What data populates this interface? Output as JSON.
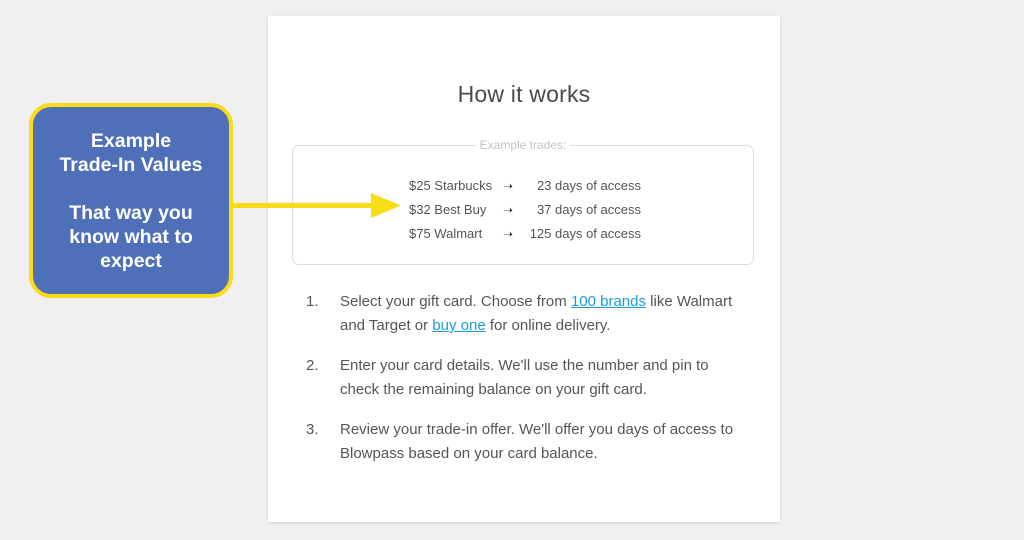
{
  "card": {
    "title": "How it works",
    "example_trades": {
      "legend": "Example trades:",
      "arrow_glyph": "➝",
      "rows": [
        {
          "from": "$25 Starbucks",
          "to": "23 days of access"
        },
        {
          "from": "$32 Best Buy",
          "to": "37 days of access"
        },
        {
          "from": "$75 Walmart",
          "to": "125 days of access"
        }
      ]
    },
    "steps": [
      {
        "number": "1.",
        "text_before": "Select your gift card. Choose from ",
        "link1": "100 brands",
        "text_middle": " like Walmart and Target or ",
        "link2": "buy one",
        "text_after": " for online delivery."
      },
      {
        "number": "2.",
        "text": "Enter your card details. We'll use the number and pin to check the remaining balance on your gift card."
      },
      {
        "number": "3.",
        "text": "Review your trade-in offer. We'll offer you days of access to Blowpass based on your card balance."
      }
    ]
  },
  "annotation": {
    "heading_line1": "Example",
    "heading_line2": "Trade-In Values",
    "body_line1": "That way you",
    "body_line2": "know what to",
    "body_line3": "expect",
    "fill_color": "#4f6fb8",
    "border_color": "#f7dc16",
    "arrow_color": "#f7dc16",
    "arrow_icon": "arrow-right-icon"
  },
  "colors": {
    "background": "#f0f0f0",
    "card": "#ffffff",
    "text": "#555555",
    "heading": "#4a4a4a",
    "link": "#1a9bd7",
    "legend": "#c4c4c4"
  }
}
